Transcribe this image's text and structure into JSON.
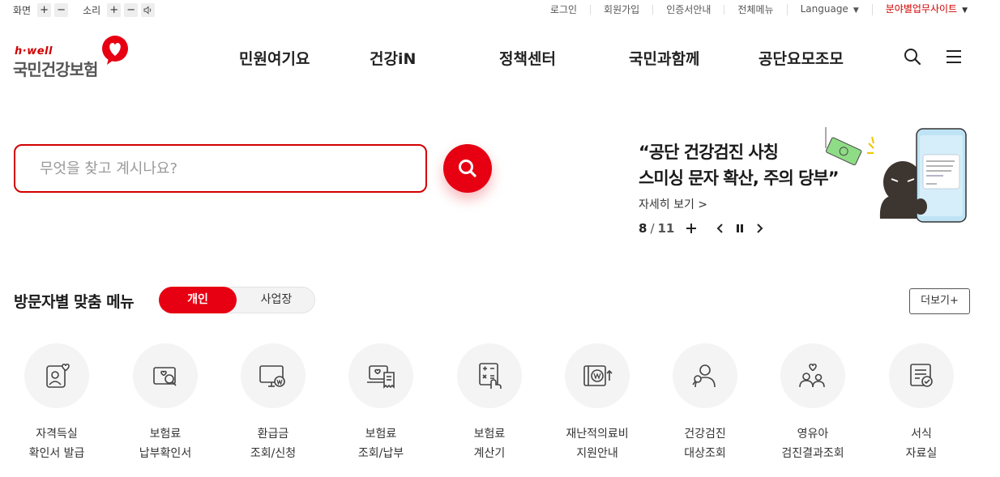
{
  "util": {
    "screen_label": "화면",
    "sound_label": "소리",
    "plus": "+",
    "minus": "−",
    "links": [
      "로그인",
      "회원가입",
      "인증서안내",
      "전체메뉴",
      "Language",
      "분야별업무사이트"
    ]
  },
  "logo": {
    "sub": "h·well",
    "main": "국민건강보험"
  },
  "gnb": [
    "민원여기요",
    "건강iN",
    "정책센터",
    "국민과함께",
    "공단요모조모"
  ],
  "search": {
    "placeholder": "무엇을 찾고 계시나요?",
    "value": ""
  },
  "banner": {
    "title_line1": "“공단 건강검진 사칭",
    "title_line2": "스미싱 문자 확산, 주의 당부”",
    "more": "자세히 보기 >",
    "current": "8",
    "slash": "/",
    "total": "11"
  },
  "visitor": {
    "title": "방문자별 맞춤 메뉴",
    "tabs": [
      "개인",
      "사업장"
    ],
    "active_tab": "개인",
    "more": "더보기+"
  },
  "menu_items": [
    {
      "l1": "자격득실",
      "l2": "확인서 발급",
      "icon": "person-card-heart-icon"
    },
    {
      "l1": "보험료",
      "l2": "납부확인서",
      "icon": "document-search-icon"
    },
    {
      "l1": "환급금",
      "l2": "조회/신청",
      "icon": "monitor-won-icon"
    },
    {
      "l1": "보험료",
      "l2": "조회/납부",
      "icon": "laptop-receipt-icon"
    },
    {
      "l1": "보험료",
      "l2": "계산기",
      "icon": "calculator-hand-icon"
    },
    {
      "l1": "재난적의료비",
      "l2": "지원안내",
      "icon": "wallet-won-up-icon"
    },
    {
      "l1": "건강검진",
      "l2": "대상조회",
      "icon": "person-search-icon"
    },
    {
      "l1": "영유아",
      "l2": "검진결과조회",
      "icon": "parent-child-heart-icon"
    },
    {
      "l1": "서식",
      "l2": "자료실",
      "icon": "form-check-icon"
    }
  ],
  "colors": {
    "brand_red": "#e60012",
    "text_red": "#d10000"
  }
}
